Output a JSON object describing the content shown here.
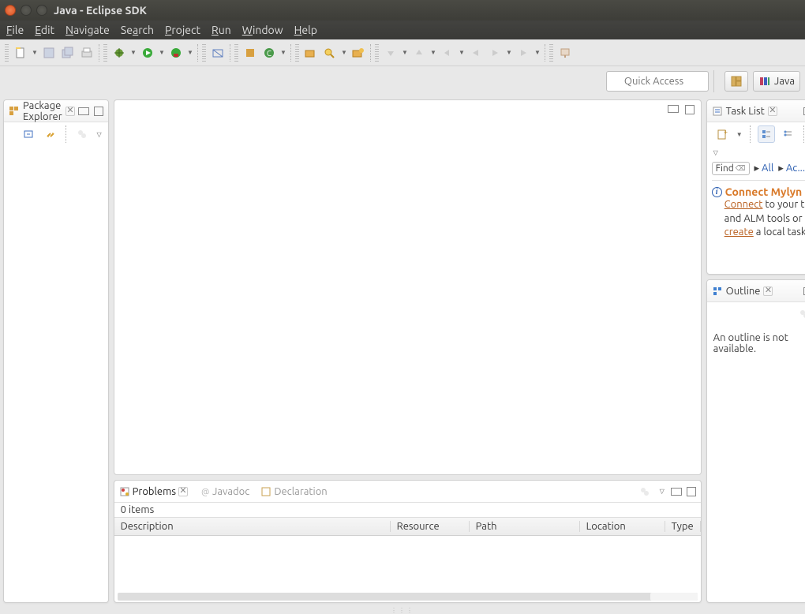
{
  "window": {
    "title": "Java - Eclipse SDK"
  },
  "menu": [
    "File",
    "Edit",
    "Navigate",
    "Search",
    "Project",
    "Run",
    "Window",
    "Help"
  ],
  "quick_access": {
    "placeholder": "Quick Access"
  },
  "perspective": {
    "current": "Java"
  },
  "views": {
    "package_explorer": {
      "title": "Package Explorer"
    },
    "task_list": {
      "title": "Task List",
      "find": "Find",
      "all": "All",
      "activate": "Ac...",
      "mylyn_title": "Connect Mylyn",
      "mylyn_connect": "Connect",
      "mylyn_mid": " to your task and ALM tools or ",
      "mylyn_create": "create",
      "mylyn_tail": " a local task."
    },
    "outline": {
      "title": "Outline",
      "empty": "An outline is not available."
    }
  },
  "problems": {
    "tab_problems": "Problems",
    "tab_javadoc": "Javadoc",
    "tab_declaration": "Declaration",
    "count": "0 items",
    "cols": {
      "description": "Description",
      "resource": "Resource",
      "path": "Path",
      "location": "Location",
      "type": "Type"
    }
  }
}
